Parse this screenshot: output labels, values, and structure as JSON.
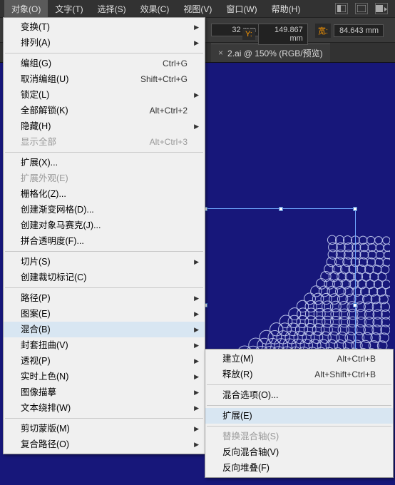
{
  "menubar": {
    "items": [
      "对象(O)",
      "文字(T)",
      "选择(S)",
      "效果(C)",
      "视图(V)",
      "窗口(W)",
      "帮助(H)"
    ]
  },
  "toolbar": {
    "x_value": "32",
    "y_label": "Y:",
    "y_value": "149.867",
    "w_label": "宽:",
    "w_value": "84.643",
    "unit": "mm"
  },
  "doc_tab": {
    "title": "2.ai @ 150% (RGB/预览)",
    "close": "×"
  },
  "menu": {
    "items": [
      {
        "label": "变换(T)",
        "arrow": true
      },
      {
        "label": "排列(A)",
        "arrow": true
      },
      {
        "sep": true
      },
      {
        "label": "编组(G)",
        "shortcut": "Ctrl+G"
      },
      {
        "label": "取消编组(U)",
        "shortcut": "Shift+Ctrl+G"
      },
      {
        "label": "锁定(L)",
        "arrow": true
      },
      {
        "label": "全部解锁(K)",
        "shortcut": "Alt+Ctrl+2"
      },
      {
        "label": "隐藏(H)",
        "arrow": true
      },
      {
        "label": "显示全部",
        "shortcut": "Alt+Ctrl+3",
        "disabled": true
      },
      {
        "sep": true
      },
      {
        "label": "扩展(X)..."
      },
      {
        "label": "扩展外观(E)",
        "disabled": true
      },
      {
        "label": "栅格化(Z)..."
      },
      {
        "label": "创建渐变网格(D)..."
      },
      {
        "label": "创建对象马赛克(J)..."
      },
      {
        "label": "拼合透明度(F)..."
      },
      {
        "sep": true
      },
      {
        "label": "切片(S)",
        "arrow": true
      },
      {
        "label": "创建裁切标记(C)"
      },
      {
        "sep": true
      },
      {
        "label": "路径(P)",
        "arrow": true
      },
      {
        "label": "图案(E)",
        "arrow": true
      },
      {
        "label": "混合(B)",
        "arrow": true,
        "hover": true
      },
      {
        "label": "封套扭曲(V)",
        "arrow": true
      },
      {
        "label": "透视(P)",
        "arrow": true
      },
      {
        "label": "实时上色(N)",
        "arrow": true
      },
      {
        "label": "图像描摹",
        "arrow": true
      },
      {
        "label": "文本绕排(W)",
        "arrow": true
      },
      {
        "sep": true
      },
      {
        "label": "剪切蒙版(M)",
        "arrow": true
      },
      {
        "label": "复合路径(O)",
        "arrow": true
      }
    ]
  },
  "submenu": {
    "items": [
      {
        "label": "建立(M)",
        "shortcut": "Alt+Ctrl+B"
      },
      {
        "label": "释放(R)",
        "shortcut": "Alt+Shift+Ctrl+B"
      },
      {
        "sep": true
      },
      {
        "label": "混合选项(O)..."
      },
      {
        "sep": true
      },
      {
        "label": "扩展(E)",
        "hover": true
      },
      {
        "sep": true
      },
      {
        "label": "替换混合轴(S)",
        "disabled": true
      },
      {
        "label": "反向混合轴(V)"
      },
      {
        "label": "反向堆叠(F)"
      }
    ]
  }
}
